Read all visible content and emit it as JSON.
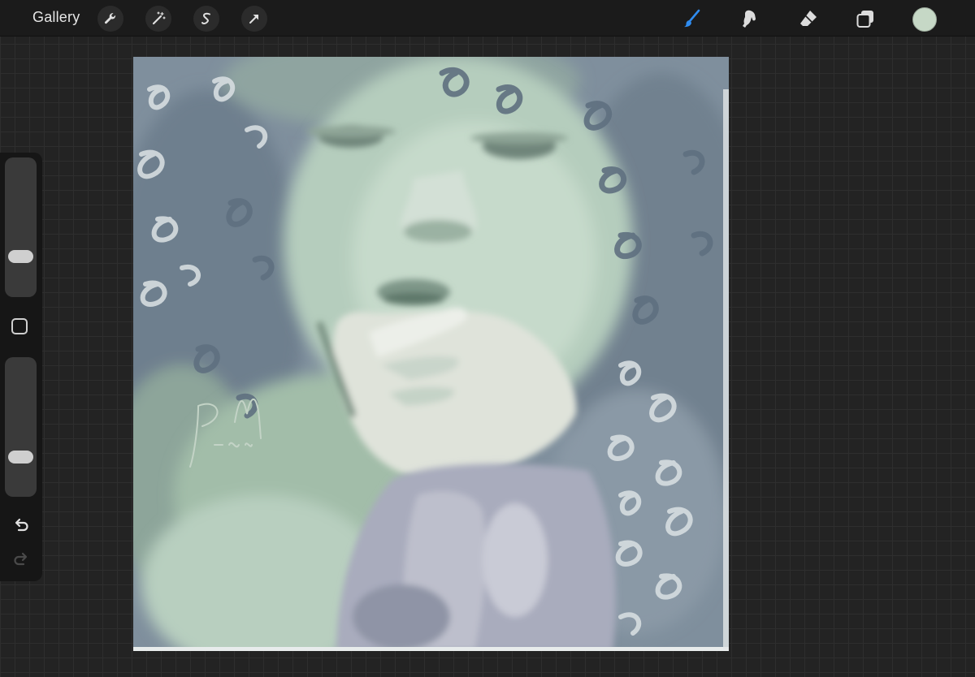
{
  "topbar": {
    "gallery_label": "Gallery",
    "left_tools": [
      "wrench-icon",
      "magic-wand-icon",
      "selection-icon",
      "transform-arrow-icon"
    ],
    "right_tools": [
      "brush-icon",
      "smudge-icon",
      "eraser-icon",
      "layers-icon"
    ],
    "active_tool": "brush-icon",
    "accent": "#2f8cf0",
    "current_color": "#c6d8c6"
  },
  "sidebar": {
    "brush_size_level": 0.26,
    "opacity_level": 0.25,
    "buttons": [
      "modify-icon",
      "undo-icon",
      "redo-icon"
    ]
  },
  "canvas": {
    "palette": {
      "hair_blue_gray": "#7e8e9c",
      "skin_mint": "#c2d6c8",
      "shadow_green": "#7f9a8a",
      "sleeve_lavender": "#a9acbc",
      "highlight": "#e6ebe6"
    },
    "signature_text": "P.M."
  }
}
